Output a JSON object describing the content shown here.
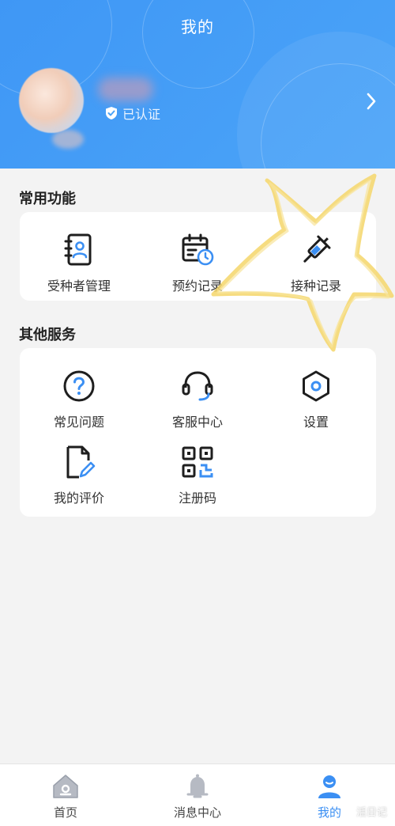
{
  "header": {
    "title": "我的",
    "verified_label": "已认证"
  },
  "common": {
    "title": "常用功能",
    "items": [
      {
        "label": "受种者管理",
        "icon": "person-card-icon"
      },
      {
        "label": "预约记录",
        "icon": "calendar-clock-icon"
      },
      {
        "label": "接种记录",
        "icon": "syringe-icon"
      }
    ]
  },
  "other": {
    "title": "其他服务",
    "items": [
      {
        "label": "常见问题",
        "icon": "question-circle-icon"
      },
      {
        "label": "客服中心",
        "icon": "headset-icon"
      },
      {
        "label": "设置",
        "icon": "hexagon-gear-icon"
      },
      {
        "label": "我的评价",
        "icon": "document-pen-icon"
      },
      {
        "label": "注册码",
        "icon": "qr-code-icon"
      }
    ]
  },
  "tabbar": {
    "items": [
      {
        "label": "首页",
        "icon": "home-icon",
        "active": false
      },
      {
        "label": "消息中心",
        "icon": "bell-icon",
        "active": false
      },
      {
        "label": "我的",
        "icon": "user-icon",
        "active": true
      }
    ]
  },
  "watermark": "活日记",
  "colors": {
    "accent": "#3b8ff3",
    "header_start": "#3f97f5",
    "header_end": "#4ba4f8",
    "background": "#f3f3f3",
    "icon_dark": "#1e1e1e",
    "star_overlay": "#f5d66a"
  }
}
